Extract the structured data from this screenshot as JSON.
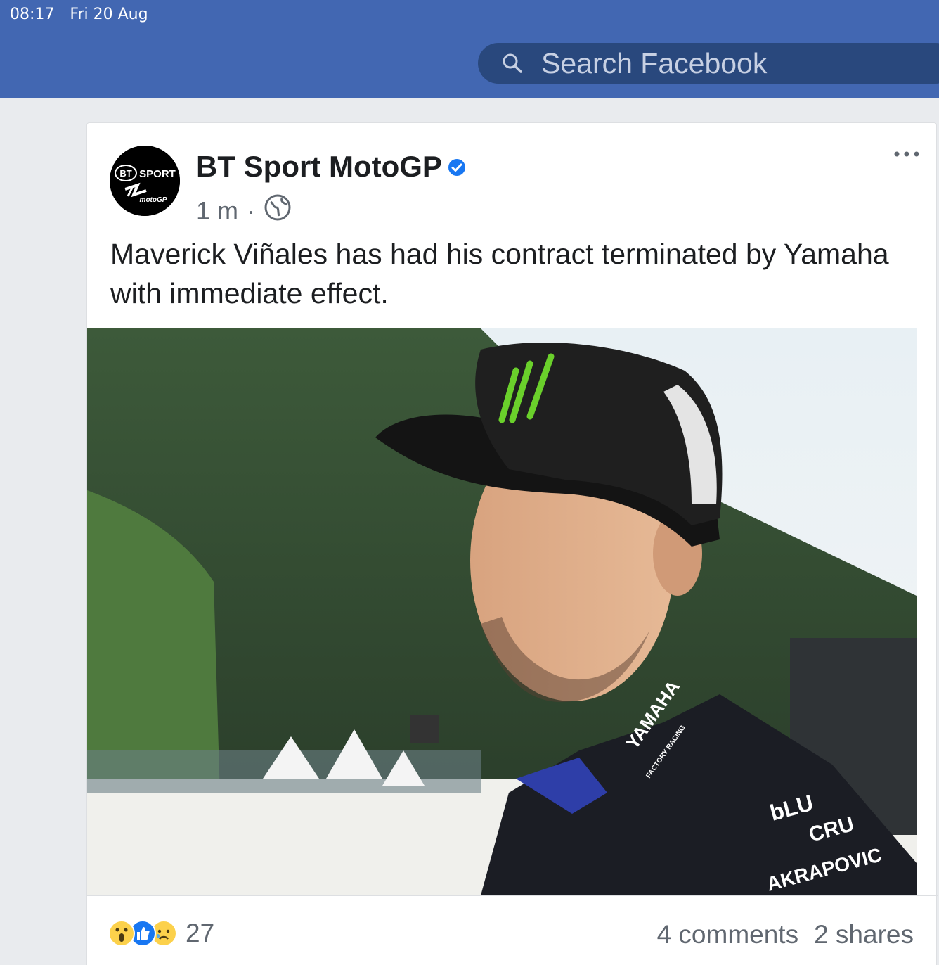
{
  "status_bar": {
    "time": "08:17",
    "date": "Fri 20 Aug"
  },
  "header": {
    "search_placeholder": "Search Facebook",
    "search_icon": "search-icon"
  },
  "post": {
    "page_name": "BT Sport MotoGP",
    "verified_icon": "verified-badge-icon",
    "time_ago": "1 m",
    "separator": "·",
    "audience_icon": "globe-icon",
    "text": "Maverick Viñales has had his contract terminated by Yamaha with immediate effect.",
    "avatar_logo": {
      "line1": "BT",
      "line2": "SPORT",
      "line3": "motoGP"
    },
    "photo_texts": [
      "YAMAHA",
      "FACTORY RACING",
      "bLU",
      "CRU",
      "AKRAPOVIC"
    ],
    "reactions": {
      "icons": [
        "wow-reaction-icon",
        "like-reaction-icon",
        "sad-reaction-icon"
      ],
      "count": "27"
    },
    "comments": "4 comments",
    "shares": "2 shares"
  },
  "colors": {
    "facebook_blue": "#4267b2",
    "search_bg": "#29487d",
    "verified": "#1877f2"
  }
}
